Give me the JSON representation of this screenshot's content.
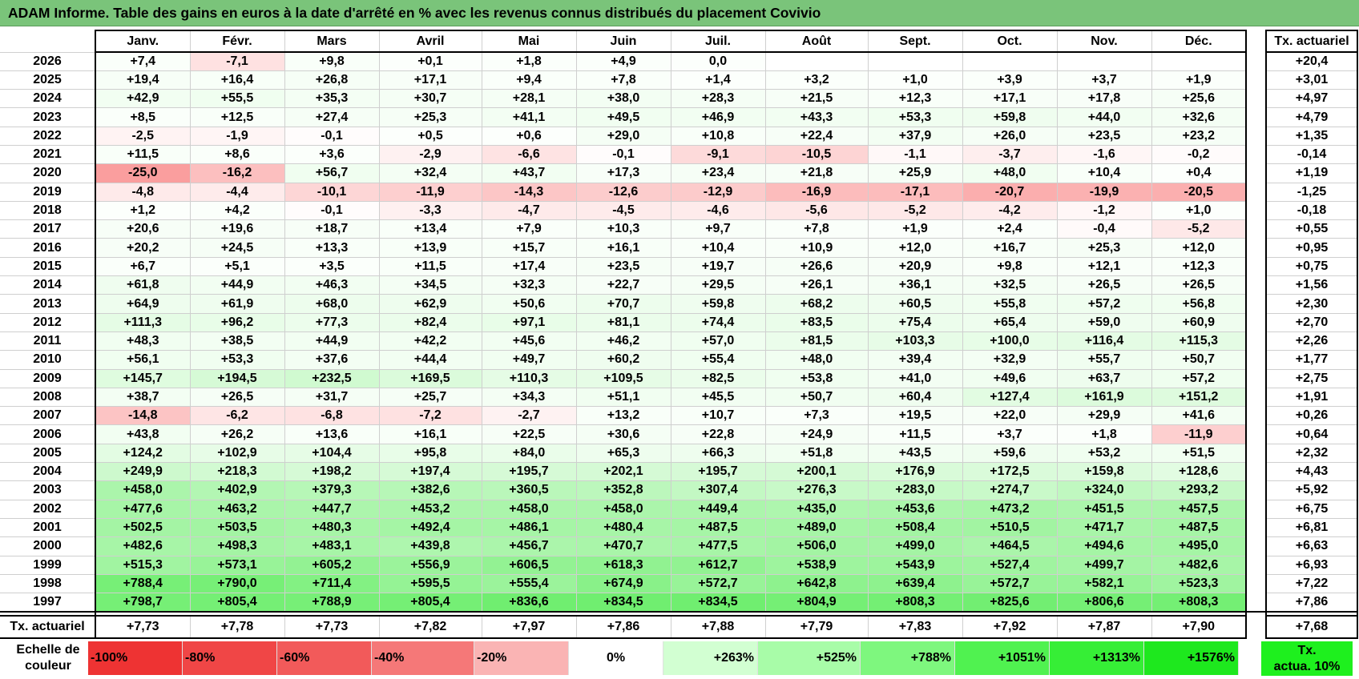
{
  "title": "ADAM Informe. Table des gains en euros à la date d'arrêté en % avec les revenus connus distribués du placement Covivio",
  "months": [
    "Janv.",
    "Févr.",
    "Mars",
    "Avril",
    "Mai",
    "Juin",
    "Juil.",
    "Août",
    "Sept.",
    "Oct.",
    "Nov.",
    "Déc."
  ],
  "rate_header": "Tx. actuariel",
  "rows": [
    {
      "year": "2026",
      "values": [
        "+7,4",
        "-7,1",
        "+9,8",
        "+0,1",
        "+1,8",
        "+4,9",
        "0,0",
        "",
        "",
        "",
        "",
        ""
      ],
      "rate": "+20,4"
    },
    {
      "year": "2025",
      "values": [
        "+19,4",
        "+16,4",
        "+26,8",
        "+17,1",
        "+9,4",
        "+7,8",
        "+1,4",
        "+3,2",
        "+1,0",
        "+3,9",
        "+3,7",
        "+1,9"
      ],
      "rate": "+3,01"
    },
    {
      "year": "2024",
      "values": [
        "+42,9",
        "+55,5",
        "+35,3",
        "+30,7",
        "+28,1",
        "+38,0",
        "+28,3",
        "+21,5",
        "+12,3",
        "+17,1",
        "+17,8",
        "+25,6"
      ],
      "rate": "+4,97"
    },
    {
      "year": "2023",
      "values": [
        "+8,5",
        "+12,5",
        "+27,4",
        "+25,3",
        "+41,1",
        "+49,5",
        "+46,9",
        "+43,3",
        "+53,3",
        "+59,8",
        "+44,0",
        "+32,6"
      ],
      "rate": "+4,79"
    },
    {
      "year": "2022",
      "values": [
        "-2,5",
        "-1,9",
        "-0,1",
        "+0,5",
        "+0,6",
        "+29,0",
        "+10,8",
        "+22,4",
        "+37,9",
        "+26,0",
        "+23,5",
        "+23,2"
      ],
      "rate": "+1,35"
    },
    {
      "year": "2021",
      "values": [
        "+11,5",
        "+8,6",
        "+3,6",
        "-2,9",
        "-6,6",
        "-0,1",
        "-9,1",
        "-10,5",
        "-1,1",
        "-3,7",
        "-1,6",
        "-0,2"
      ],
      "rate": "-0,14"
    },
    {
      "year": "2020",
      "values": [
        "-25,0",
        "-16,2",
        "+56,7",
        "+32,4",
        "+43,7",
        "+17,3",
        "+23,4",
        "+21,8",
        "+25,9",
        "+48,0",
        "+10,4",
        "+0,4"
      ],
      "rate": "+1,19"
    },
    {
      "year": "2019",
      "values": [
        "-4,8",
        "-4,4",
        "-10,1",
        "-11,9",
        "-14,3",
        "-12,6",
        "-12,9",
        "-16,9",
        "-17,1",
        "-20,7",
        "-19,9",
        "-20,5"
      ],
      "rate": "-1,25"
    },
    {
      "year": "2018",
      "values": [
        "+1,2",
        "+4,2",
        "-0,1",
        "-3,3",
        "-4,7",
        "-4,5",
        "-4,6",
        "-5,6",
        "-5,2",
        "-4,2",
        "-1,2",
        "+1,0"
      ],
      "rate": "-0,18"
    },
    {
      "year": "2017",
      "values": [
        "+20,6",
        "+19,6",
        "+18,7",
        "+13,4",
        "+7,9",
        "+10,3",
        "+9,7",
        "+7,8",
        "+1,9",
        "+2,4",
        "-0,4",
        "-5,2"
      ],
      "rate": "+0,55"
    },
    {
      "year": "2016",
      "values": [
        "+20,2",
        "+24,5",
        "+13,3",
        "+13,9",
        "+15,7",
        "+16,1",
        "+10,4",
        "+10,9",
        "+12,0",
        "+16,7",
        "+25,3",
        "+12,0"
      ],
      "rate": "+0,95"
    },
    {
      "year": "2015",
      "values": [
        "+6,7",
        "+5,1",
        "+3,5",
        "+11,5",
        "+17,4",
        "+23,5",
        "+19,7",
        "+26,6",
        "+20,9",
        "+9,8",
        "+12,1",
        "+12,3"
      ],
      "rate": "+0,75"
    },
    {
      "year": "2014",
      "values": [
        "+61,8",
        "+44,9",
        "+46,3",
        "+34,5",
        "+32,3",
        "+22,7",
        "+29,5",
        "+26,1",
        "+36,1",
        "+32,5",
        "+26,5",
        "+26,5"
      ],
      "rate": "+1,56"
    },
    {
      "year": "2013",
      "values": [
        "+64,9",
        "+61,9",
        "+68,0",
        "+62,9",
        "+50,6",
        "+70,7",
        "+59,8",
        "+68,2",
        "+60,5",
        "+55,8",
        "+57,2",
        "+56,8"
      ],
      "rate": "+2,30"
    },
    {
      "year": "2012",
      "values": [
        "+111,3",
        "+96,2",
        "+77,3",
        "+82,4",
        "+97,1",
        "+81,1",
        "+74,4",
        "+83,5",
        "+75,4",
        "+65,4",
        "+59,0",
        "+60,9"
      ],
      "rate": "+2,70"
    },
    {
      "year": "2011",
      "values": [
        "+48,3",
        "+38,5",
        "+44,9",
        "+42,2",
        "+45,6",
        "+46,2",
        "+57,0",
        "+81,5",
        "+103,3",
        "+100,0",
        "+116,4",
        "+115,3"
      ],
      "rate": "+2,26"
    },
    {
      "year": "2010",
      "values": [
        "+56,1",
        "+53,3",
        "+37,6",
        "+44,4",
        "+49,7",
        "+60,2",
        "+55,4",
        "+48,0",
        "+39,4",
        "+32,9",
        "+55,7",
        "+50,7"
      ],
      "rate": "+1,77"
    },
    {
      "year": "2009",
      "values": [
        "+145,7",
        "+194,5",
        "+232,5",
        "+169,5",
        "+110,3",
        "+109,5",
        "+82,5",
        "+53,8",
        "+41,0",
        "+49,6",
        "+63,7",
        "+57,2"
      ],
      "rate": "+2,75"
    },
    {
      "year": "2008",
      "values": [
        "+38,7",
        "+26,5",
        "+31,7",
        "+25,7",
        "+34,3",
        "+51,1",
        "+45,5",
        "+50,7",
        "+60,4",
        "+127,4",
        "+161,9",
        "+151,2"
      ],
      "rate": "+1,91"
    },
    {
      "year": "2007",
      "values": [
        "-14,8",
        "-6,2",
        "-6,8",
        "-7,2",
        "-2,7",
        "+13,2",
        "+10,7",
        "+7,3",
        "+19,5",
        "+22,0",
        "+29,9",
        "+41,6"
      ],
      "rate": "+0,26"
    },
    {
      "year": "2006",
      "values": [
        "+43,8",
        "+26,2",
        "+13,6",
        "+16,1",
        "+22,5",
        "+30,6",
        "+22,8",
        "+24,9",
        "+11,5",
        "+3,7",
        "+1,8",
        "-11,9"
      ],
      "rate": "+0,64"
    },
    {
      "year": "2005",
      "values": [
        "+124,2",
        "+102,9",
        "+104,4",
        "+95,8",
        "+84,0",
        "+65,3",
        "+66,3",
        "+51,8",
        "+43,5",
        "+59,6",
        "+53,2",
        "+51,5"
      ],
      "rate": "+2,32"
    },
    {
      "year": "2004",
      "values": [
        "+249,9",
        "+218,3",
        "+198,2",
        "+197,4",
        "+195,7",
        "+202,1",
        "+195,7",
        "+200,1",
        "+176,9",
        "+172,5",
        "+159,8",
        "+128,6"
      ],
      "rate": "+4,43"
    },
    {
      "year": "2003",
      "values": [
        "+458,0",
        "+402,9",
        "+379,3",
        "+382,6",
        "+360,5",
        "+352,8",
        "+307,4",
        "+276,3",
        "+283,0",
        "+274,7",
        "+324,0",
        "+293,2"
      ],
      "rate": "+5,92"
    },
    {
      "year": "2002",
      "values": [
        "+477,6",
        "+463,2",
        "+447,7",
        "+453,2",
        "+458,0",
        "+458,0",
        "+449,4",
        "+435,0",
        "+453,6",
        "+473,2",
        "+451,5",
        "+457,5"
      ],
      "rate": "+6,75"
    },
    {
      "year": "2001",
      "values": [
        "+502,5",
        "+503,5",
        "+480,3",
        "+492,4",
        "+486,1",
        "+480,4",
        "+487,5",
        "+489,0",
        "+508,4",
        "+510,5",
        "+471,7",
        "+487,5"
      ],
      "rate": "+6,81"
    },
    {
      "year": "2000",
      "values": [
        "+482,6",
        "+498,3",
        "+483,1",
        "+439,8",
        "+456,7",
        "+470,7",
        "+477,5",
        "+506,0",
        "+499,0",
        "+464,5",
        "+494,6",
        "+495,0"
      ],
      "rate": "+6,63"
    },
    {
      "year": "1999",
      "values": [
        "+515,3",
        "+573,1",
        "+605,2",
        "+556,9",
        "+606,5",
        "+618,3",
        "+612,7",
        "+538,9",
        "+543,9",
        "+527,4",
        "+499,7",
        "+482,6"
      ],
      "rate": "+6,93"
    },
    {
      "year": "1998",
      "values": [
        "+788,4",
        "+790,0",
        "+711,4",
        "+595,5",
        "+555,4",
        "+674,9",
        "+572,7",
        "+642,8",
        "+639,4",
        "+572,7",
        "+582,1",
        "+523,3"
      ],
      "rate": "+7,22"
    },
    {
      "year": "1997",
      "values": [
        "+798,7",
        "+805,4",
        "+788,9",
        "+805,4",
        "+836,6",
        "+834,5",
        "+834,5",
        "+804,9",
        "+808,3",
        "+825,6",
        "+806,6",
        "+808,3"
      ],
      "rate": "+7,86"
    }
  ],
  "footer": {
    "label": "Tx. actuariel",
    "values": [
      "+7,73",
      "+7,78",
      "+7,73",
      "+7,82",
      "+7,97",
      "+7,86",
      "+7,88",
      "+7,79",
      "+7,83",
      "+7,92",
      "+7,87",
      "+7,90"
    ],
    "rate": "+7,68"
  },
  "legend": {
    "label_line1": "Echelle de",
    "label_line2": "couleur",
    "cells": [
      {
        "text": "-100%",
        "color": "#ee3333"
      },
      {
        "text": "-80%",
        "color": "#f04646"
      },
      {
        "text": "-60%",
        "color": "#f25a5a"
      },
      {
        "text": "-40%",
        "color": "#f57878"
      },
      {
        "text": "-20%",
        "color": "#fab4b4"
      },
      {
        "text": "0%",
        "color": "#ffffff"
      },
      {
        "text": "+263%",
        "color": "#d2ffd2"
      },
      {
        "text": "+525%",
        "color": "#a8fca8"
      },
      {
        "text": "+788%",
        "color": "#7ef77e"
      },
      {
        "text": "+1051%",
        "color": "#50f250"
      },
      {
        "text": "+1313%",
        "color": "#36ee36"
      },
      {
        "text": "+1576%",
        "color": "#1ee81e"
      }
    ],
    "rate_line1": "Tx.",
    "rate_line2": "actua. 10%",
    "rate_color": "#1ef01e"
  }
}
